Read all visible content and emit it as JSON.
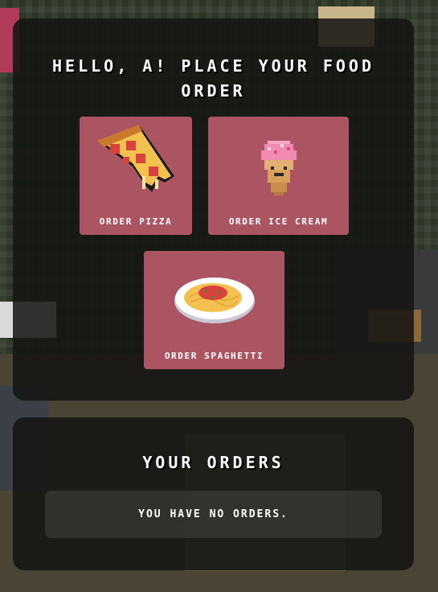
{
  "order_section": {
    "title": "Hello, A! Place your food order",
    "items": [
      {
        "label": "Order Pizza",
        "icon": "pizza-icon"
      },
      {
        "label": "Order Ice Cream",
        "icon": "ice-cream-icon"
      },
      {
        "label": "Order Spaghetti",
        "icon": "spaghetti-icon"
      }
    ]
  },
  "orders_section": {
    "title": "Your Orders",
    "empty_message": "You have no orders."
  },
  "colors": {
    "card_background": "#ab5563",
    "panel_background": "#141412",
    "text": "#ffffff"
  }
}
